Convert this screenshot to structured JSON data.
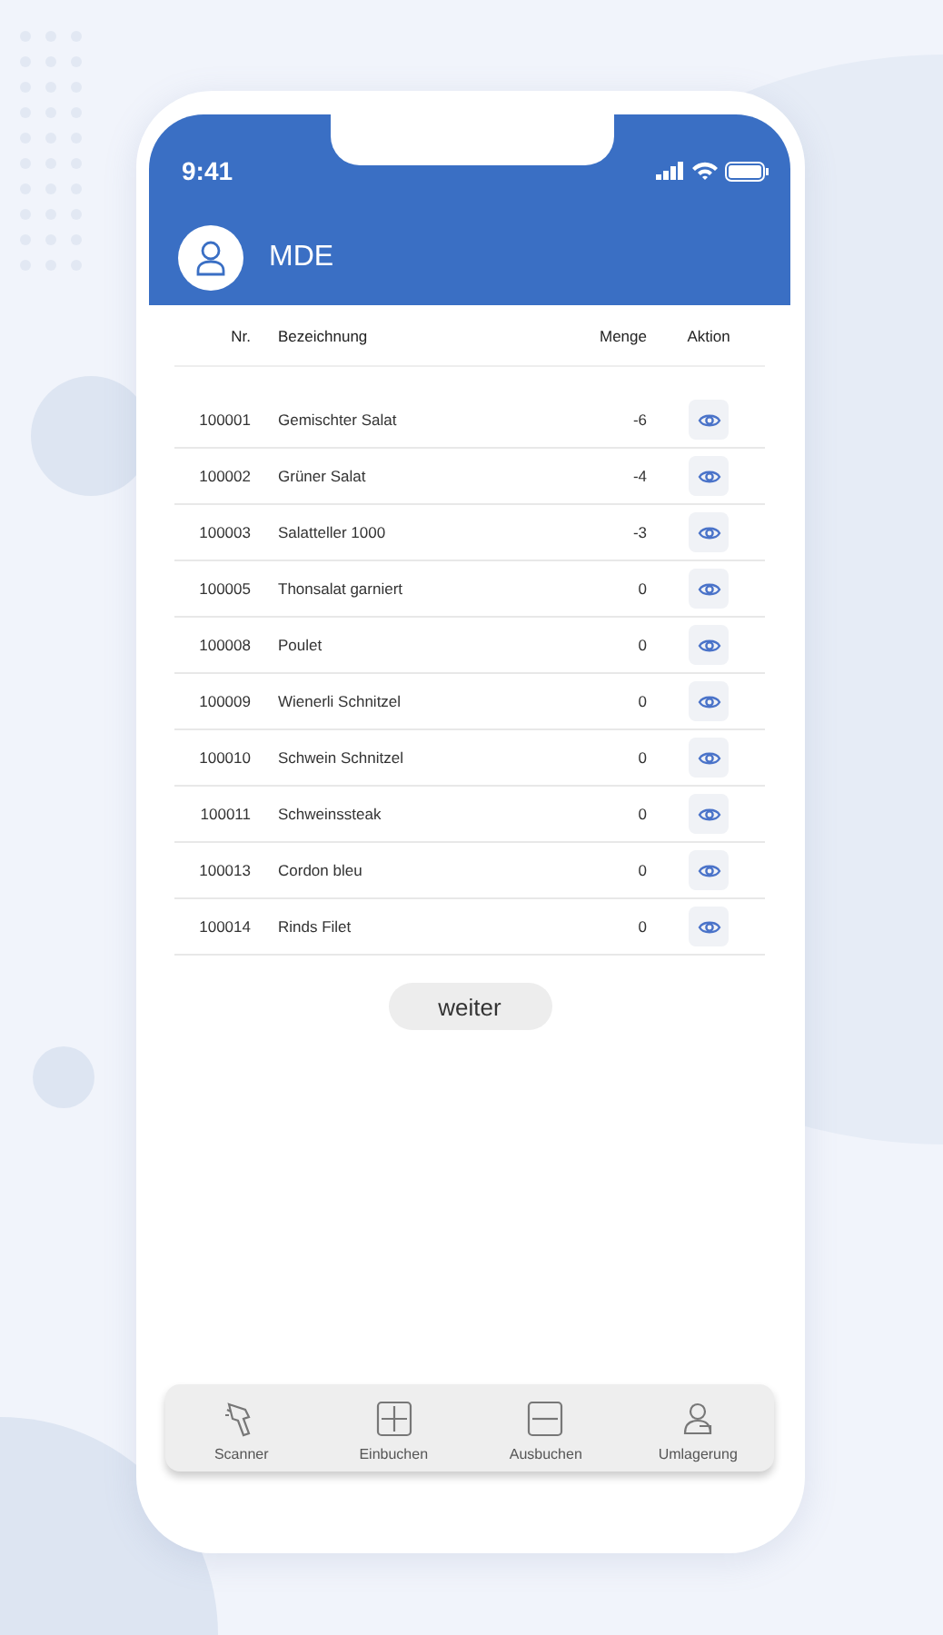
{
  "status_bar": {
    "time": "9:41"
  },
  "header": {
    "title": "MDE"
  },
  "table": {
    "columns": [
      "Nr.",
      "Bezeichnung",
      "Menge",
      "Aktion"
    ],
    "rows": [
      {
        "nr": "100001",
        "name": "Gemischter Salat",
        "quantity": "-6"
      },
      {
        "nr": "100002",
        "name": "Grüner Salat",
        "quantity": "-4"
      },
      {
        "nr": "100003",
        "name": "Salatteller 1000",
        "quantity": "-3"
      },
      {
        "nr": "100005",
        "name": "Thonsalat garniert",
        "quantity": "0"
      },
      {
        "nr": "100008",
        "name": "Poulet",
        "quantity": "0"
      },
      {
        "nr": "100009",
        "name": "Wienerli Schnitzel",
        "quantity": "0"
      },
      {
        "nr": "100010",
        "name": "Schwein Schnitzel",
        "quantity": "0"
      },
      {
        "nr": "100011",
        "name": "Schweinssteak",
        "quantity": "0"
      },
      {
        "nr": "100013",
        "name": "Cordon bleu",
        "quantity": "0"
      },
      {
        "nr": "100014",
        "name": "Rinds Filet",
        "quantity": "0"
      }
    ]
  },
  "next_button": "weiter",
  "tab_bar": [
    {
      "label": "Scanner",
      "kind": "scanner"
    },
    {
      "label": "Einbuchen",
      "kind": "plus"
    },
    {
      "label": "Ausbuchen",
      "kind": "minus"
    },
    {
      "label": "Umlagerung",
      "kind": "transfer"
    }
  ]
}
